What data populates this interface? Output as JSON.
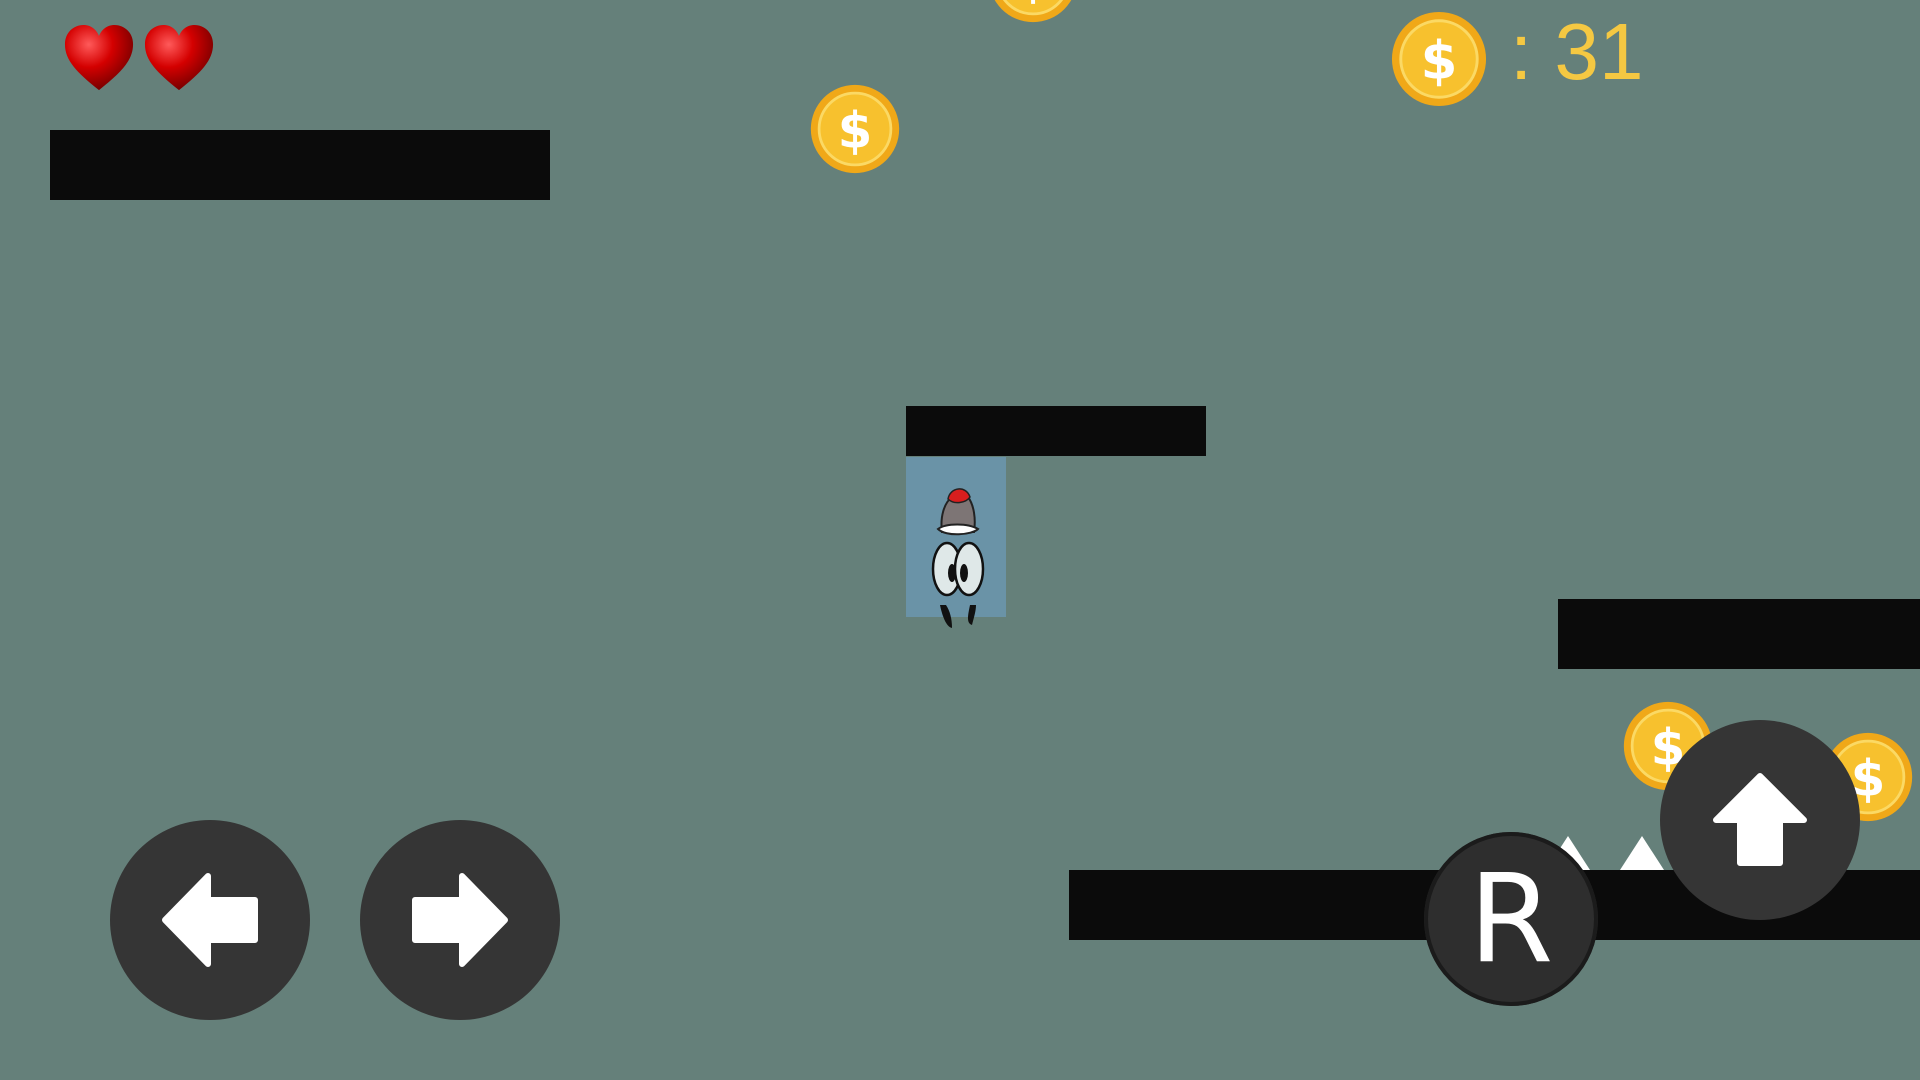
{
  "hud": {
    "lives": 2,
    "coin_count_text": ": 31",
    "heart_icon": "heart-icon",
    "coin_icon": "coin-icon"
  },
  "controls": {
    "left": {
      "icon": "arrow-left-icon"
    },
    "right": {
      "icon": "arrow-right-icon"
    },
    "jump": {
      "icon": "arrow-up-icon"
    },
    "restart_label": "R"
  },
  "colors": {
    "background": "#65807a",
    "platform": "#0b0b0b",
    "coin_gold": "#f5b71c",
    "score_text": "#f5c842",
    "button": "#353535",
    "heart": "#d40000"
  }
}
